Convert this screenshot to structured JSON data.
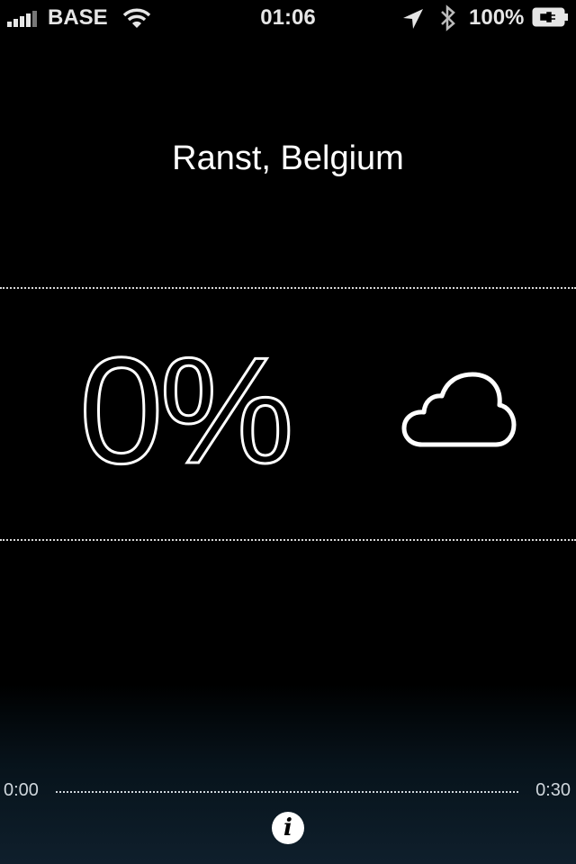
{
  "status_bar": {
    "carrier": "BASE",
    "time": "01:06",
    "battery_percent": "100%",
    "signal_icon": "signal-bars-icon",
    "wifi_icon": "wifi-icon",
    "location_icon": "location-arrow-icon",
    "bluetooth_icon": "bluetooth-icon",
    "battery_icon": "battery-charging-icon"
  },
  "main": {
    "location": "Ranst, Belgium",
    "precipitation_chance": "0%",
    "weather_icon": "cloud-icon"
  },
  "timeline": {
    "start_label": "0:00",
    "end_label": "0:30"
  },
  "footer": {
    "info_label": "i"
  }
}
